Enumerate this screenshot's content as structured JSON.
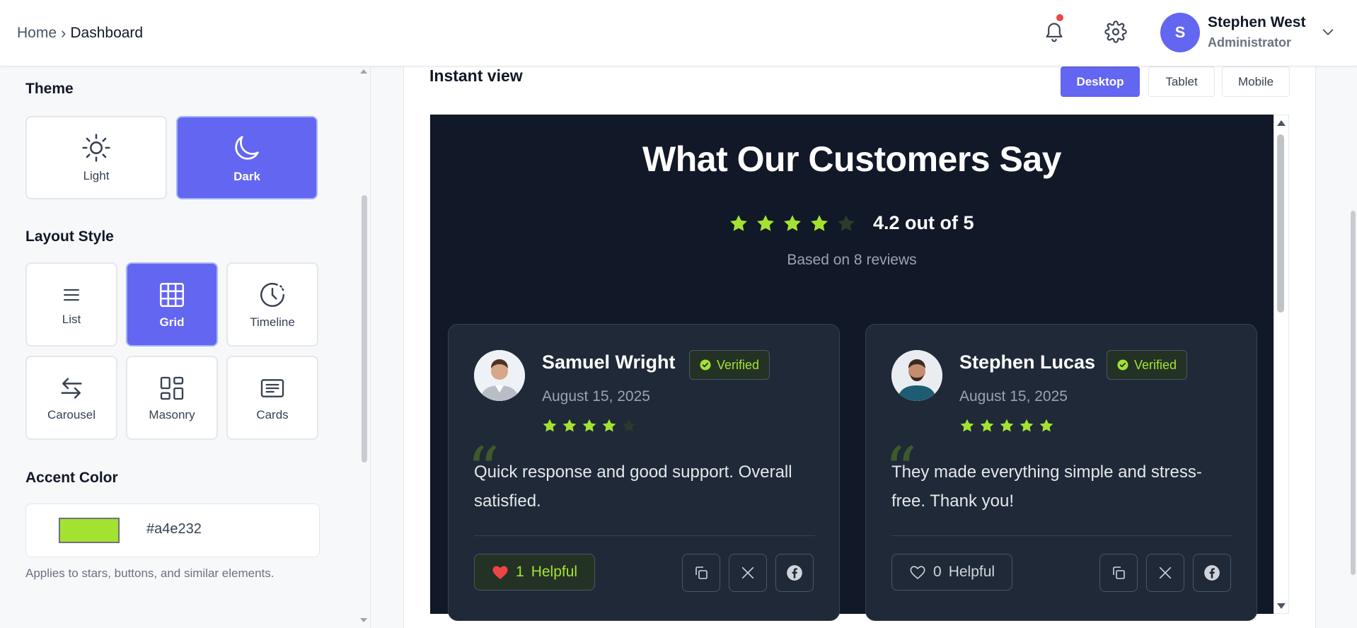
{
  "breadcrumb": {
    "home": "Home",
    "separator": "›",
    "current": "Dashboard"
  },
  "header": {
    "user": {
      "initial": "S",
      "name": "Stephen West",
      "role": "Administrator"
    },
    "icons": {
      "notifications": "bell-icon",
      "settings": "gear-icon",
      "menu": "chevron-down-icon"
    }
  },
  "sidebar": {
    "theme": {
      "title": "Theme",
      "options": [
        {
          "label": "Light",
          "icon": "sun-icon",
          "selected": false
        },
        {
          "label": "Dark",
          "icon": "moon-icon",
          "selected": true
        }
      ]
    },
    "layout": {
      "title": "Layout Style",
      "options": [
        {
          "label": "List",
          "icon": "list-icon",
          "selected": false
        },
        {
          "label": "Grid",
          "icon": "grid-icon",
          "selected": true
        },
        {
          "label": "Timeline",
          "icon": "clock-icon",
          "selected": false
        },
        {
          "label": "Carousel",
          "icon": "arrows-icon",
          "selected": false
        },
        {
          "label": "Masonry",
          "icon": "masonry-icon",
          "selected": false
        },
        {
          "label": "Cards",
          "icon": "card-icon",
          "selected": false
        }
      ]
    },
    "accent": {
      "title": "Accent Color",
      "value": "#a4e232",
      "helper": "Applies to stars, buttons, and similar elements."
    }
  },
  "main": {
    "title": "Instant view",
    "tabs": [
      {
        "label": "Desktop",
        "active": true
      },
      {
        "label": "Tablet",
        "active": false
      },
      {
        "label": "Mobile",
        "active": false
      }
    ],
    "preview": {
      "heading": "What Our Customers Say",
      "rating": {
        "stars": 4,
        "max": 5,
        "text": "4.2 out of 5"
      },
      "based_on": "Based on 8 reviews",
      "reviews": [
        {
          "name": "Samuel Wright",
          "badge": "Verified",
          "date": "August 15, 2025",
          "stars": 4,
          "text": "Quick response and good support. Overall satisfied.",
          "helpful_count": "1",
          "helpful_label": "Helpful",
          "liked": true
        },
        {
          "name": "Stephen Lucas",
          "badge": "Verified",
          "date": "August 15, 2025",
          "stars": 5,
          "text": "They made everything simple and stress-free. Thank you!",
          "helpful_count": "0",
          "helpful_label": "Helpful",
          "liked": false
        }
      ]
    }
  },
  "colors": {
    "accent": "#a4e232",
    "primary": "#6366f1",
    "preview_bg": "#111827",
    "card_bg": "#1f2937",
    "notification_dot": "#ef4444"
  }
}
